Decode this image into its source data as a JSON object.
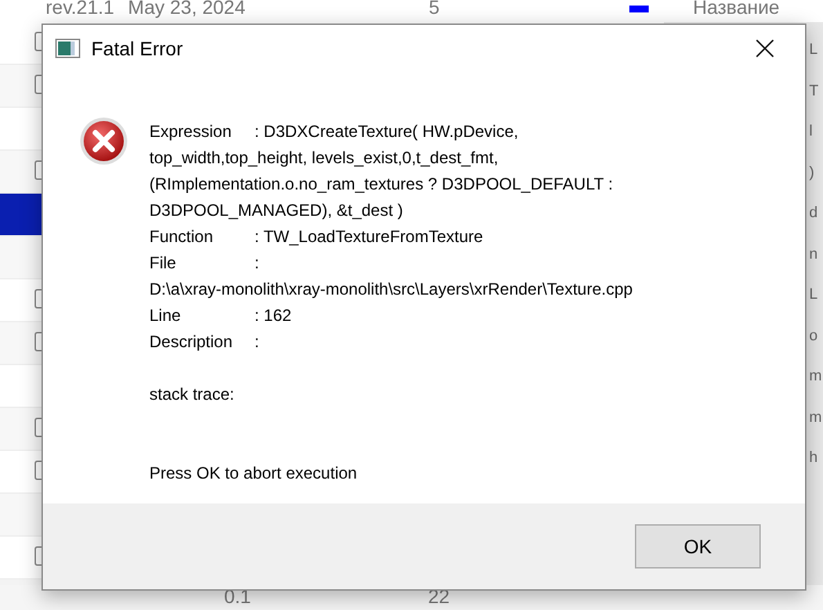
{
  "background": {
    "top_row": {
      "version": "rev.21.1",
      "date": "May 23, 2024",
      "count": "5"
    },
    "panel_header": "Название",
    "panel_items": [
      "L",
      "T",
      "l",
      ")",
      "d",
      "n",
      "L",
      "o",
      "m",
      "m",
      "h"
    ],
    "rows": [
      {
        "selected": false
      },
      {
        "selected": false
      },
      {
        "selected": false
      },
      {
        "selected": false
      },
      {
        "selected": true
      },
      {
        "selected": false
      },
      {
        "selected": false
      },
      {
        "selected": false
      },
      {
        "selected": false
      },
      {
        "selected": false
      },
      {
        "selected": false
      },
      {
        "selected": false
      },
      {
        "selected": false
      }
    ],
    "bottom_row": {
      "column_1": "0.1",
      "column_2": "22"
    }
  },
  "dialog": {
    "title": "Fatal Error",
    "lines": [
      {
        "kind": "field",
        "label": "Expression",
        "value": ": D3DXCreateTexture( HW.pDevice, top_width,top_height, levels_exist,0,t_dest_fmt, (RImplementation.o.no_ram_textures ? D3DPOOL_DEFAULT : D3DPOOL_MANAGED), &t_dest )"
      },
      {
        "kind": "field",
        "label": "Function",
        "value": ": TW_LoadTextureFromTexture"
      },
      {
        "kind": "field",
        "label": "File",
        "value": ":"
      },
      {
        "kind": "text",
        "text": "D:\\a\\xray-monolith\\xray-monolith\\src\\Layers\\xrRender\\Texture.cpp"
      },
      {
        "kind": "field",
        "label": "Line",
        "value": ": 162"
      },
      {
        "kind": "field",
        "label": "Description",
        "value": ":"
      },
      {
        "kind": "note",
        "text": "stack trace:"
      }
    ],
    "footer_text": "Press OK to abort execution",
    "buttons": [
      "OK"
    ]
  }
}
